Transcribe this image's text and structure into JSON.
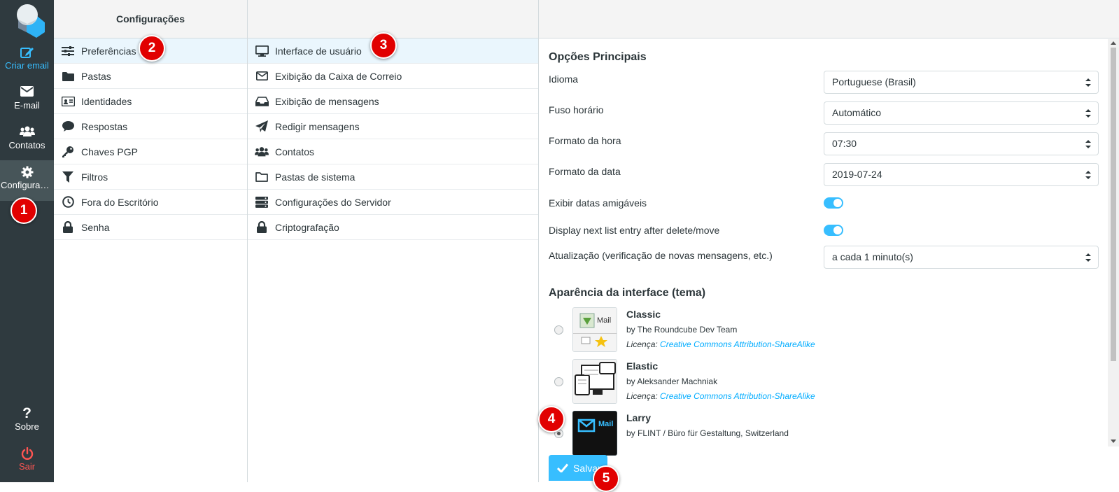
{
  "rail": {
    "compose": {
      "label": "Criar email",
      "icon": "compose-icon"
    },
    "mail": {
      "label": "E-mail",
      "icon": "envelope-icon"
    },
    "contacts": {
      "label": "Contatos",
      "icon": "users-icon"
    },
    "settings": {
      "label": "Configurações",
      "icon": "gear-icon"
    },
    "about": {
      "label": "Sobre",
      "icon": "question-icon"
    },
    "logout": {
      "label": "Sair",
      "icon": "power-icon"
    }
  },
  "settings_panel": {
    "title": "Configurações",
    "items": [
      {
        "label": "Preferências",
        "icon": "sliders-icon"
      },
      {
        "label": "Pastas",
        "icon": "folder-icon"
      },
      {
        "label": "Identidades",
        "icon": "id-card-icon"
      },
      {
        "label": "Respostas",
        "icon": "comment-icon"
      },
      {
        "label": "Chaves PGP",
        "icon": "key-icon"
      },
      {
        "label": "Filtros",
        "icon": "filter-icon"
      },
      {
        "label": "Fora do Escritório",
        "icon": "clock-icon"
      },
      {
        "label": "Senha",
        "icon": "lock-icon"
      }
    ]
  },
  "sections_panel": {
    "items": [
      {
        "label": "Interface de usuário",
        "icon": "monitor-icon"
      },
      {
        "label": "Exibição da Caixa de Correio",
        "icon": "envelope-outline-icon"
      },
      {
        "label": "Exibição de mensagens",
        "icon": "inbox-icon"
      },
      {
        "label": "Redigir mensagens",
        "icon": "paper-plane-icon"
      },
      {
        "label": "Contatos",
        "icon": "users-icon"
      },
      {
        "label": "Pastas de sistema",
        "icon": "folder-outline-icon"
      },
      {
        "label": "Configurações do Servidor",
        "icon": "server-icon"
      },
      {
        "label": "Criptografação",
        "icon": "lock-icon"
      }
    ]
  },
  "main": {
    "section_title": "Opções Principais",
    "language": {
      "label": "Idioma",
      "value": "Portuguese (Brasil)"
    },
    "timezone": {
      "label": "Fuso horário",
      "value": "Automático"
    },
    "time_format": {
      "label": "Formato da hora",
      "value": "07:30"
    },
    "date_format": {
      "label": "Formato da data",
      "value": "2019-07-24"
    },
    "pretty_dates": {
      "label": "Exibir datas amigáveis",
      "enabled": true
    },
    "display_next": {
      "label": "Display next list entry after delete/move",
      "enabled": true
    },
    "refresh": {
      "label": "Atualização (verificação de novas mensagens, etc.)",
      "value": "a cada 1 minuto(s)"
    },
    "skin_title": "Aparência da interface (tema)",
    "skins": [
      {
        "name": "Classic",
        "author": "by The Roundcube Dev Team",
        "license_label": "Licença:",
        "license": "Creative Commons Attribution-ShareAlike",
        "selected": false,
        "thumb_text": "Mail"
      },
      {
        "name": "Elastic",
        "author": "by Aleksander Machniak",
        "license_label": "Licença:",
        "license": "Creative Commons Attribution-ShareAlike",
        "selected": false
      },
      {
        "name": "Larry",
        "author": "by FLINT / Büro für Gestaltung, Switzerland",
        "selected": true,
        "thumb_text": "Mail"
      }
    ],
    "save_label": "Salvar"
  },
  "markers": [
    "1",
    "2",
    "3",
    "4",
    "5"
  ],
  "colors": {
    "accent": "#37beff",
    "rail": "#2f3a3f",
    "marker": "#e10000",
    "logout": "#ff5552"
  }
}
